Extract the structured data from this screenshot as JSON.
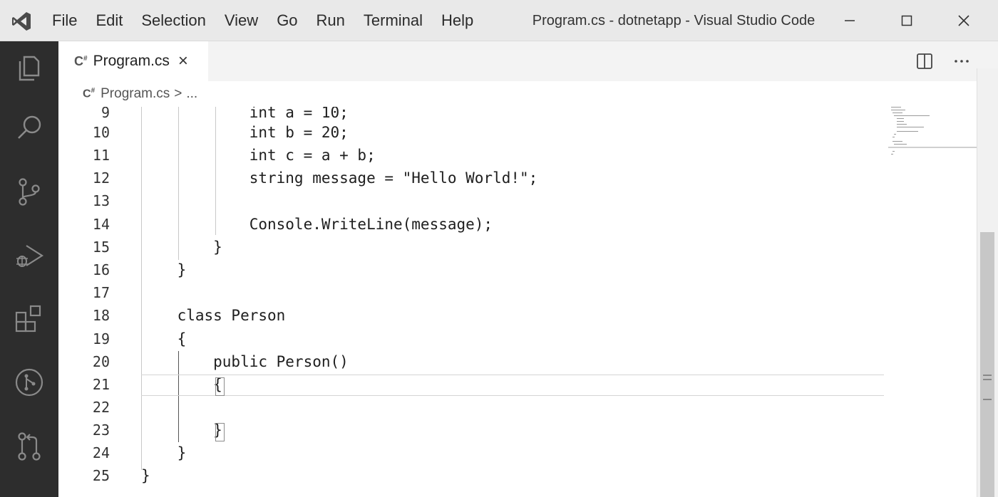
{
  "titlebar": {
    "menu": [
      "File",
      "Edit",
      "Selection",
      "View",
      "Go",
      "Run",
      "Terminal",
      "Help"
    ],
    "window_title": "Program.cs - dotnetapp - Visual Studio Code"
  },
  "activity_bar": [
    "explorer-icon",
    "search-icon",
    "source-control-icon",
    "run-debug-icon",
    "extensions-icon",
    "remote-icon",
    "pull-requests-icon"
  ],
  "tab": {
    "label": "Program.cs",
    "close": "×"
  },
  "breadcrumb": {
    "file": "Program.cs",
    "separator": ">",
    "more": "..."
  },
  "editor": {
    "lines": [
      {
        "num": "9",
        "code": "            int a = 10;"
      },
      {
        "num": "10",
        "code": "            int b = 20;"
      },
      {
        "num": "11",
        "code": "            int c = a + b;"
      },
      {
        "num": "12",
        "code": "            string message = \"Hello World!\";"
      },
      {
        "num": "13",
        "code": ""
      },
      {
        "num": "14",
        "code": "            Console.WriteLine(message);"
      },
      {
        "num": "15",
        "code": "        }"
      },
      {
        "num": "16",
        "code": "    }"
      },
      {
        "num": "17",
        "code": ""
      },
      {
        "num": "18",
        "code": "    class Person"
      },
      {
        "num": "19",
        "code": "    {"
      },
      {
        "num": "20",
        "code": "        public Person()"
      },
      {
        "num": "21",
        "code": "        {"
      },
      {
        "num": "22",
        "code": ""
      },
      {
        "num": "23",
        "code": "        }"
      },
      {
        "num": "24",
        "code": "    }"
      },
      {
        "num": "25",
        "code": "}"
      }
    ],
    "current_line": "21"
  },
  "colors": {
    "activity_bar_bg": "#2d2d2d",
    "titlebar_bg": "#e9e9e9",
    "editor_bg": "#ffffff"
  }
}
